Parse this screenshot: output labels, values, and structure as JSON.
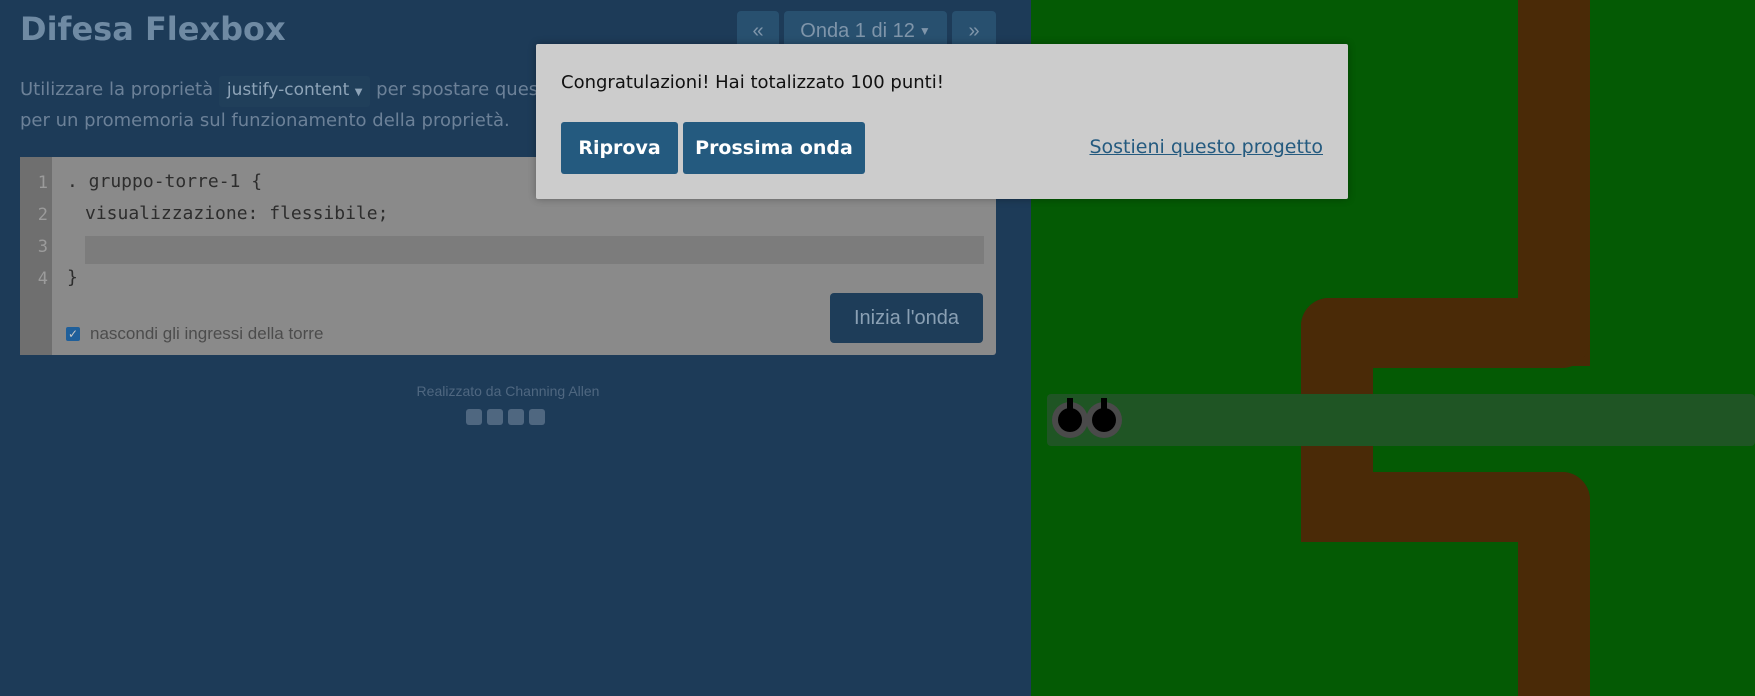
{
  "app": {
    "title": "Difesa Flexbox"
  },
  "nav": {
    "prev": "«",
    "wave_label": "Onda 1 di 12",
    "next": "»"
  },
  "instructions": {
    "before": "Utilizzare la proprietà",
    "property": "justify-content",
    "after": "per spostare queste",
    "line2": "per un promemoria sul funzionamento della proprietà."
  },
  "editor": {
    "line_numbers": [
      "1",
      "2",
      "3",
      "4"
    ],
    "lines": [
      ". gruppo-torre-1 {",
      "visualizzazione: flessibile;",
      "",
      "}"
    ],
    "input_value": "",
    "start_button": "Inizia l'onda",
    "hide_entrances_label": "nascondi gli ingressi della torre",
    "hide_entrances_checked": true
  },
  "footer": {
    "credits": "Realizzato da Channing Allen",
    "social_icons": [
      "facebook-icon",
      "twitter-icon",
      "linkedin-icon",
      "github-icon"
    ]
  },
  "modal": {
    "message": "Congratulazioni! Hai totalizzato 100 punti!",
    "retry": "Riprova",
    "next_wave": "Prossima onda",
    "support_link": "Sostieni questo progetto"
  },
  "colors": {
    "grass": "#045a04",
    "path": "#4a2a07",
    "modal_button": "#245a7f"
  }
}
